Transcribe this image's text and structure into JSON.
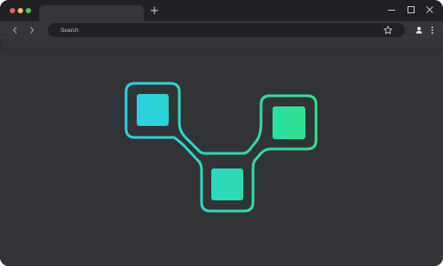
{
  "browser": {
    "search": {
      "placeholder": "Search"
    },
    "icons": {
      "close": "close-dot",
      "minimize": "minimize-dot",
      "zoom": "zoom-dot",
      "new_tab": "plus-icon",
      "back": "chevron-left-icon",
      "forward": "chevron-right-icon",
      "bookmark": "star-icon",
      "profile": "person-icon",
      "menu": "kebab-menu-icon",
      "win_minimize": "minimize-icon",
      "win_maximize": "maximize-icon",
      "win_close": "close-icon"
    },
    "new_tab_glyph": "+"
  },
  "colors": {
    "frame": "#202124",
    "toolbar": "#35363a",
    "page_background": "#323336",
    "traffic_red": "#ee5f5a",
    "traffic_yellow": "#f5bd4f",
    "traffic_green": "#5ec34f",
    "gradient_start": "#2ad0e8",
    "gradient_end": "#2ee38b"
  }
}
